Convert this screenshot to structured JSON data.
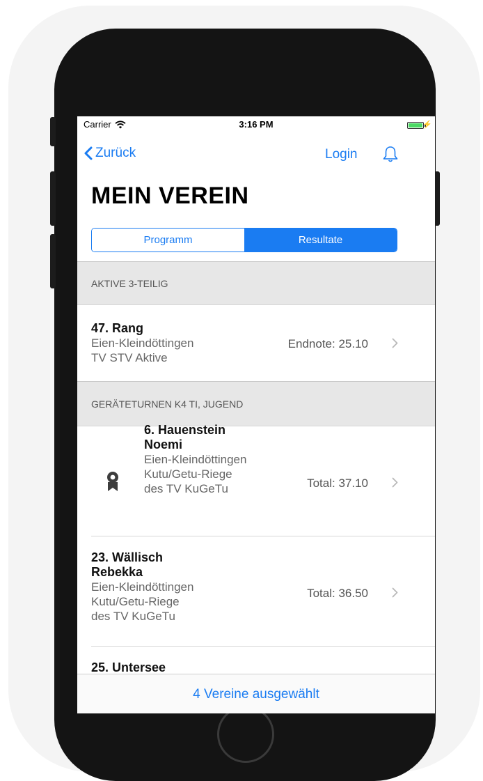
{
  "status_bar": {
    "carrier": "Carrier",
    "time": "3:16 PM"
  },
  "nav": {
    "back_label": "Zurück",
    "login_label": "Login"
  },
  "page_title": "MEIN VEREIN",
  "segments": {
    "left": "Programm",
    "right": "Resultate",
    "selected": "Resultate"
  },
  "sections": [
    {
      "header": "AKTIVE 3-TEILIG",
      "rows": [
        {
          "name": "47. Rang",
          "sub1": "Eien-Kleindöttingen",
          "sub2": "TV STV Aktive",
          "value": "Endnote: 25.10"
        }
      ]
    },
    {
      "header": "GERÄTETURNEN K4 TI, JUGEND",
      "rows": [
        {
          "name1": "6. Hauenstein",
          "name2": "Noemi",
          "sub1": "Eien-Kleindöttingen",
          "sub2": "Kutu/Getu-Riege",
          "sub3": "des TV KuGeTu",
          "value": "Total: 37.10",
          "icon": "award-ribbon-icon"
        },
        {
          "name1": "23. Wällisch",
          "name2": "Rebekka",
          "sub1": "Eien-Kleindöttingen",
          "sub2": "Kutu/Getu-Riege",
          "sub3": "des TV KuGeTu",
          "value": "Total: 36.50"
        },
        {
          "name1": "25. Untersee"
        }
      ]
    }
  ],
  "footer_label": "4 Vereine ausgewählt",
  "colors": {
    "accent": "#1a7cf2",
    "section_bg": "#e7e7e7",
    "battery": "#4cd964"
  }
}
